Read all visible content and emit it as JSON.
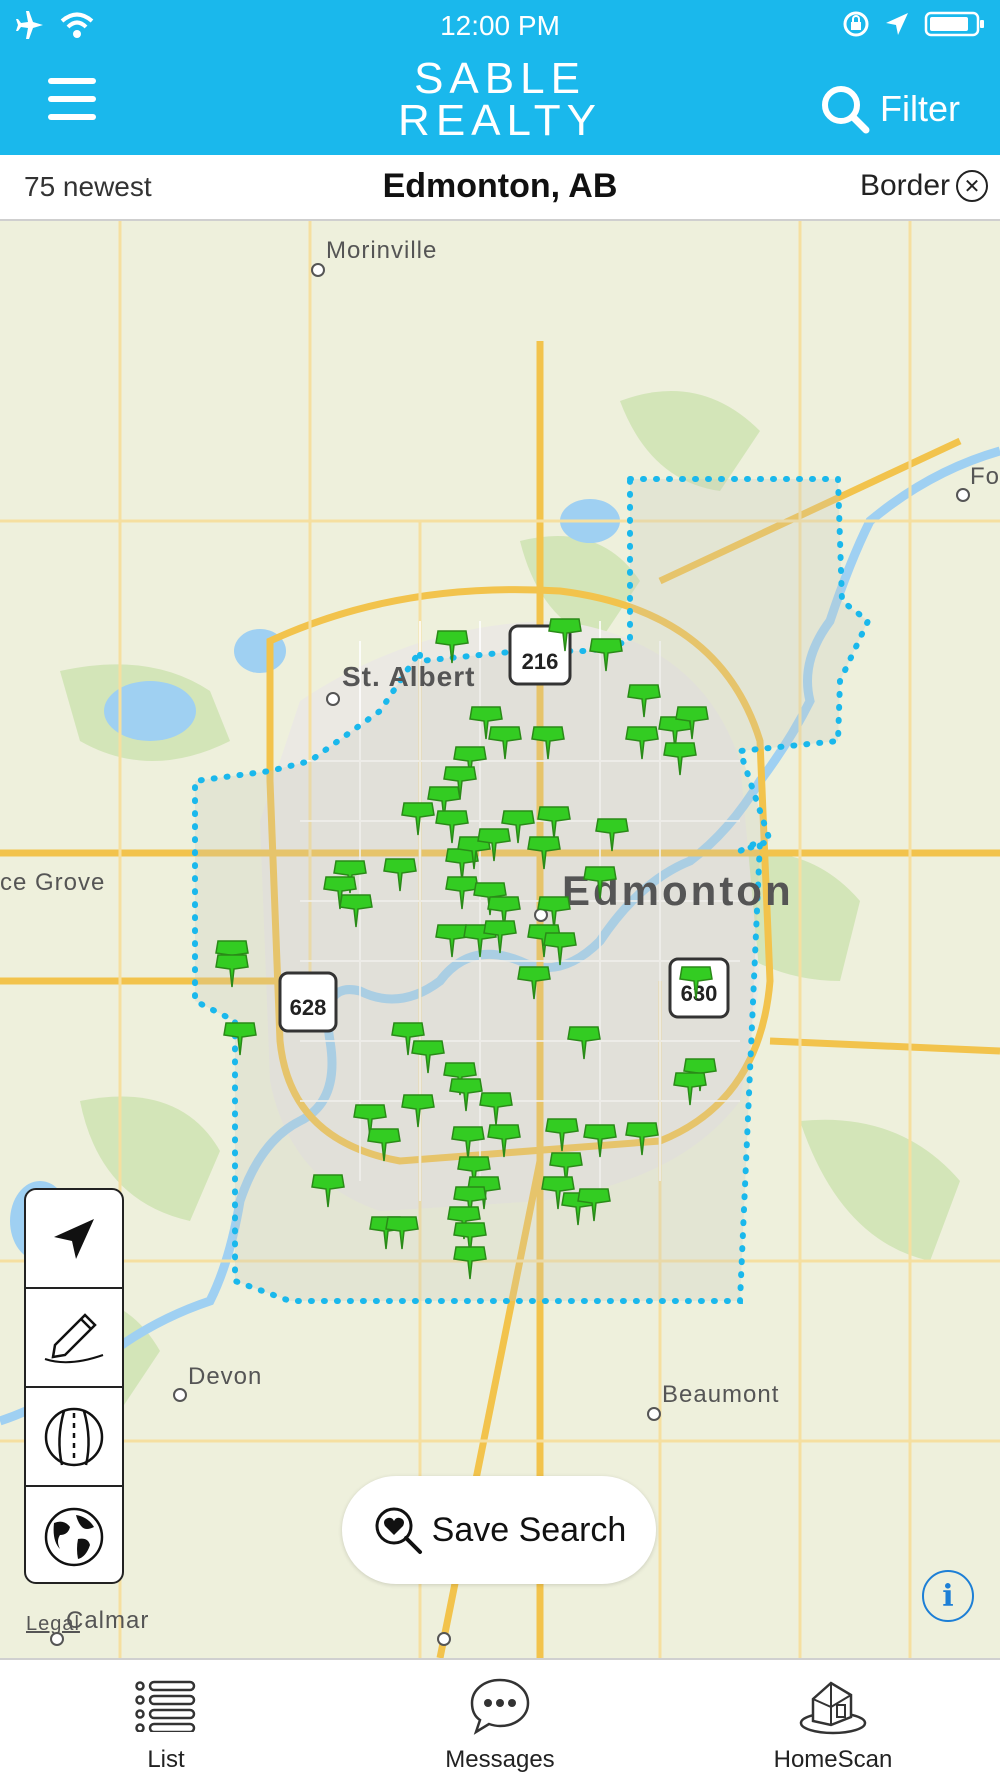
{
  "status_bar": {
    "time": "12:00 PM"
  },
  "header": {
    "logo_line1": "SABLE",
    "logo_line2": "REALTY",
    "filter_label": "Filter"
  },
  "subheader": {
    "count_label": "75 newest",
    "city": "Edmonton, AB",
    "border_label": "Border"
  },
  "map": {
    "labels": {
      "morinville": "Morinville",
      "st_albert": "St. Albert",
      "edmonton": "Edmonton",
      "spruce_grove": "ce Grove",
      "devon": "Devon",
      "beaumont": "Beaumont",
      "calmar": "Calmar",
      "legal": "Legal",
      "fort": "Fo"
    },
    "highway_shields": [
      "216",
      "628",
      "630"
    ],
    "listing_pin_color": "#33cc22",
    "border_color": "#1ab8ec"
  },
  "tools": [
    "locate",
    "draw",
    "road",
    "globe"
  ],
  "save_search_label": "Save Search",
  "info_label": "i",
  "tabs": [
    {
      "label": "List",
      "icon": "list-icon"
    },
    {
      "label": "Messages",
      "icon": "chat-bubble-icon"
    },
    {
      "label": "HomeScan",
      "icon": "house-scan-icon"
    }
  ]
}
